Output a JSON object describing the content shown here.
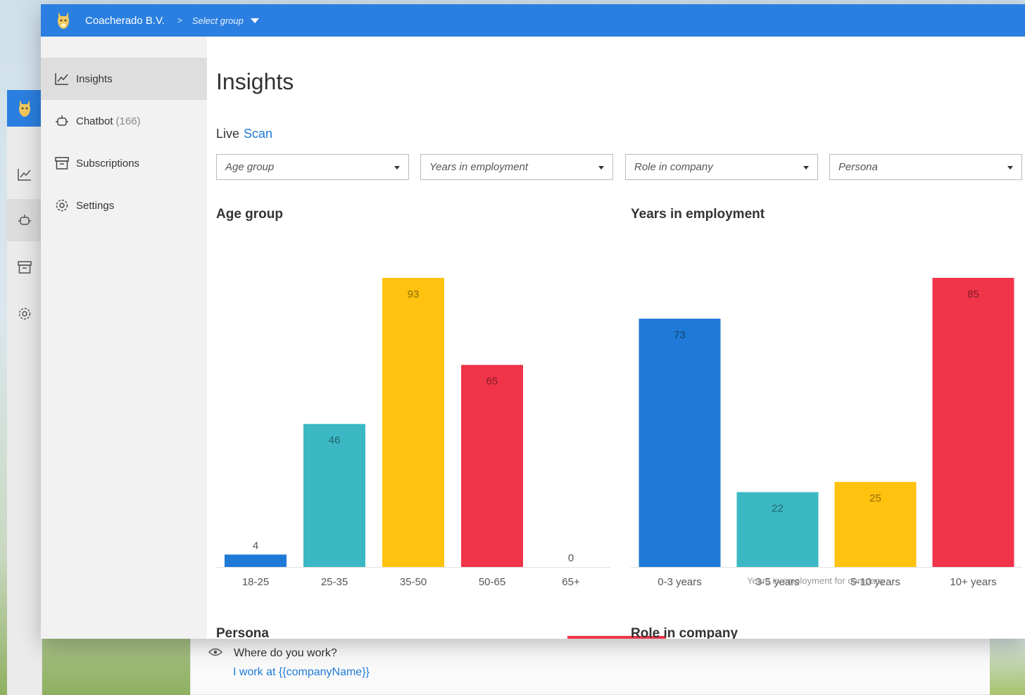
{
  "app": {
    "company": "Coacherado B.V.",
    "breadcrumb_sep": ">",
    "group_select": "Select group"
  },
  "sidebar": {
    "items": [
      {
        "label": "Insights",
        "icon": "chart-line-icon",
        "active": true
      },
      {
        "label": "Chatbot",
        "count": "(166)",
        "icon": "robot-icon"
      },
      {
        "label": "Subscriptions",
        "icon": "archive-icon"
      },
      {
        "label": "Settings",
        "icon": "gear-icon"
      }
    ]
  },
  "page": {
    "title": "Insights",
    "mode_label": "Live",
    "mode_link": "Scan"
  },
  "filters": [
    {
      "placeholder": "Age group"
    },
    {
      "placeholder": "Years in employment"
    },
    {
      "placeholder": "Role in company"
    },
    {
      "placeholder": "Persona"
    }
  ],
  "chart_data": [
    {
      "type": "bar",
      "title": "Age group",
      "categories": [
        "18-25",
        "25-35",
        "35-50",
        "50-65",
        "65+"
      ],
      "values": [
        4,
        46,
        93,
        65,
        0
      ],
      "colors": [
        "#1e7ad6",
        "#3bb8c3",
        "#ffc20e",
        "#f0344a",
        "#9b59b6"
      ]
    },
    {
      "type": "bar",
      "title": "Years in employment",
      "categories": [
        "0-3 years",
        "3-5 years",
        "5-10 years",
        "10+ years"
      ],
      "values": [
        73,
        22,
        25,
        85
      ],
      "colors": [
        "#1e7ad6",
        "#3bb8c3",
        "#ffc20e",
        "#f0344a"
      ],
      "caption": "Years in employment for company"
    }
  ],
  "bottom": {
    "left_title": "Persona",
    "right_title": "Role in company"
  },
  "background": {
    "question": "Where do you work?",
    "answer": "I work at {{companyName}}"
  },
  "colors": {
    "brand": "#2b7fe0",
    "link": "#1e7ad6"
  }
}
